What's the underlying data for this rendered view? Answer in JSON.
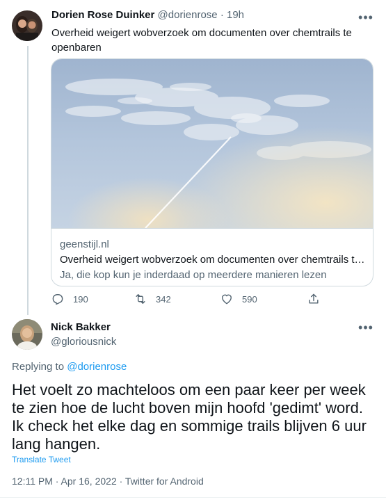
{
  "tweet1": {
    "display_name": "Dorien Rose Duinker",
    "handle": "@dorienrose",
    "separator": " · ",
    "time": "19h",
    "text": "Overheid weigert wobverzoek om documenten over chemtrails te openbaren",
    "card": {
      "domain": "geenstijl.nl",
      "title": "Overheid weigert wobverzoek om documenten over chemtrails te openbaren",
      "description": "Ja, die kop kun je inderdaad op meerdere manieren lezen"
    },
    "actions": {
      "replies": "190",
      "retweets": "342",
      "likes": "590"
    }
  },
  "tweet2": {
    "display_name": "Nick Bakker",
    "handle": "@gloriousnick",
    "replying_prefix": "Replying to ",
    "replying_to": "@dorienrose",
    "text": "Het voelt zo machteloos om een paar keer per week te zien hoe de lucht boven mijn hoofd 'gedimt' word. Ik check het elke dag en sommige trails blijven 6 uur lang hangen.",
    "translate": "Translate Tweet",
    "meta": "12:11 PM · Apr 16, 2022 · Twitter for Android"
  },
  "icons": {
    "more": "more-horizontal-icon",
    "reply": "reply-icon",
    "retweet": "retweet-icon",
    "like": "heart-icon",
    "share": "share-icon"
  },
  "colors": {
    "link": "#1d9bf0",
    "muted": "#536471",
    "text": "#0f1419",
    "border": "#cfd9de"
  }
}
